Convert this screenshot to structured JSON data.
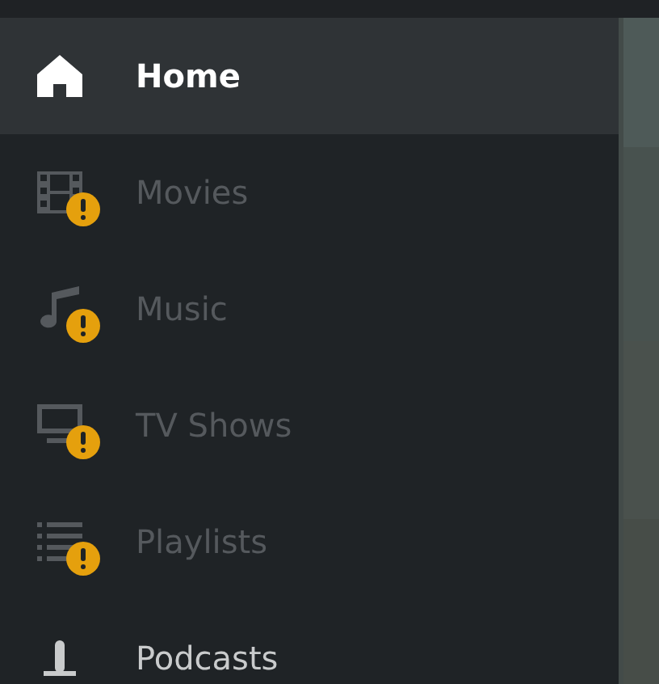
{
  "sidebar": {
    "items": [
      {
        "label": "Home",
        "kind": "home",
        "selected": true,
        "warning": false
      },
      {
        "label": "Movies",
        "kind": "film",
        "selected": false,
        "warning": true
      },
      {
        "label": "Music",
        "kind": "music",
        "selected": false,
        "warning": true
      },
      {
        "label": "TV Shows",
        "kind": "tv",
        "selected": false,
        "warning": true
      },
      {
        "label": "Playlists",
        "kind": "list",
        "selected": false,
        "warning": true
      },
      {
        "label": "Podcasts",
        "kind": "microphone",
        "selected": false,
        "warning": false
      }
    ]
  }
}
